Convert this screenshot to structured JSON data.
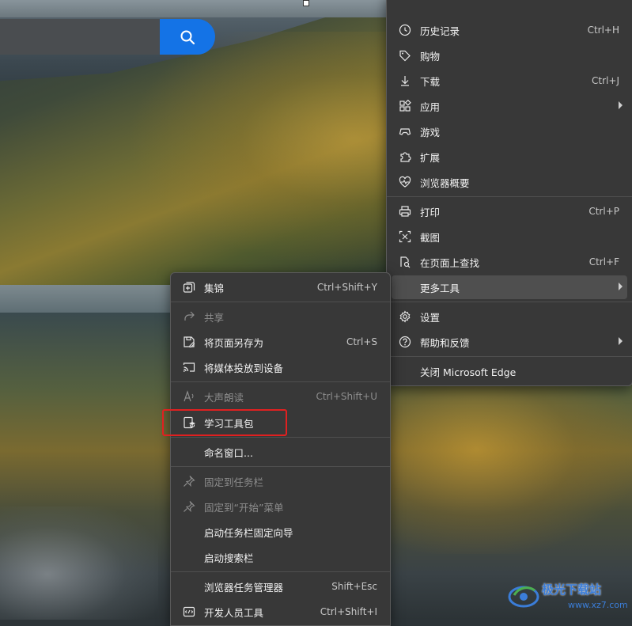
{
  "search": {
    "placeholder": ""
  },
  "main_menu": {
    "items": [
      {
        "label": "历史记录",
        "shortcut": "Ctrl+H",
        "icon": "history-icon"
      },
      {
        "label": "购物",
        "shortcut": "",
        "icon": "tag-icon"
      },
      {
        "label": "下载",
        "shortcut": "Ctrl+J",
        "icon": "download-icon"
      },
      {
        "label": "应用",
        "shortcut": "",
        "icon": "apps-icon",
        "submenu": true
      },
      {
        "label": "游戏",
        "shortcut": "",
        "icon": "gamepad-icon"
      },
      {
        "label": "扩展",
        "shortcut": "",
        "icon": "puzzle-icon"
      },
      {
        "label": "浏览器概要",
        "shortcut": "",
        "icon": "heartbeat-icon"
      },
      {
        "label": "打印",
        "shortcut": "Ctrl+P",
        "icon": "print-icon"
      },
      {
        "label": "截图",
        "shortcut": "",
        "icon": "screenshot-icon"
      },
      {
        "label": "在页面上查找",
        "shortcut": "Ctrl+F",
        "icon": "find-icon"
      },
      {
        "label": "更多工具",
        "shortcut": "",
        "icon": "",
        "submenu": true,
        "highlighted": true
      },
      {
        "label": "设置",
        "shortcut": "",
        "icon": "gear-icon"
      },
      {
        "label": "帮助和反馈",
        "shortcut": "",
        "icon": "help-icon",
        "submenu": true
      },
      {
        "label": "关闭 Microsoft Edge",
        "shortcut": "",
        "icon": ""
      }
    ]
  },
  "sub_menu": {
    "items": [
      {
        "label": "集锦",
        "shortcut": "Ctrl+Shift+Y",
        "icon": "collections-icon"
      },
      {
        "label": "共享",
        "shortcut": "",
        "icon": "share-icon",
        "disabled": true
      },
      {
        "label": "将页面另存为",
        "shortcut": "Ctrl+S",
        "icon": "save-page-icon"
      },
      {
        "label": "将媒体投放到设备",
        "shortcut": "",
        "icon": "cast-icon"
      },
      {
        "label": "大声朗读",
        "shortcut": "Ctrl+Shift+U",
        "icon": "read-aloud-icon",
        "disabled": true
      },
      {
        "label": "学习工具包",
        "shortcut": "",
        "icon": "learning-toolkit-icon"
      },
      {
        "label": "命名窗口...",
        "shortcut": "",
        "icon": ""
      },
      {
        "label": "固定到任务栏",
        "shortcut": "",
        "icon": "pin-icon",
        "disabled": true
      },
      {
        "label": "固定到“开始”菜单",
        "shortcut": "",
        "icon": "pin-icon",
        "disabled": true
      },
      {
        "label": "启动任务栏固定向导",
        "shortcut": "",
        "icon": ""
      },
      {
        "label": "启动搜索栏",
        "shortcut": "",
        "icon": ""
      },
      {
        "label": "浏览器任务管理器",
        "shortcut": "Shift+Esc",
        "icon": ""
      },
      {
        "label": "开发人员工具",
        "shortcut": "Ctrl+Shift+I",
        "icon": "devtools-icon"
      }
    ]
  },
  "watermark": {
    "text": "极光下载站",
    "url": "www.xz7.com"
  },
  "colors": {
    "menu_bg": "#383838",
    "search_accent": "#1473e6",
    "highlight_box": "#e02020"
  }
}
